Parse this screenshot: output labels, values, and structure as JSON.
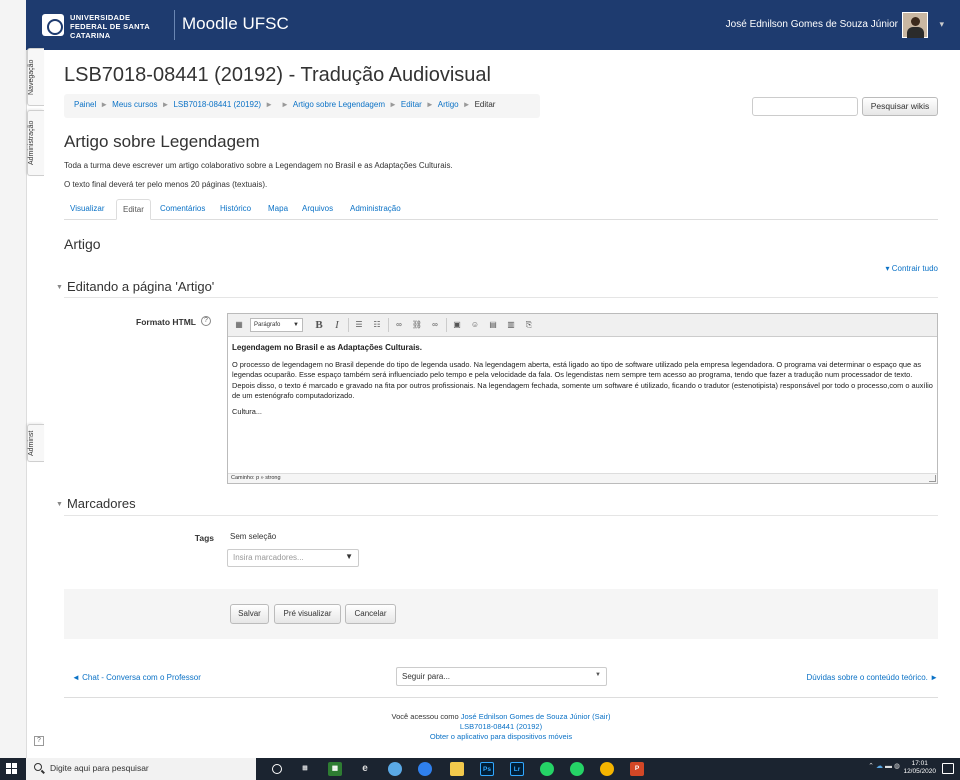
{
  "header": {
    "university": "UNIVERSIDADE FEDERAL DE SANTA CATARINA",
    "brand": "Moodle UFSC",
    "user_name": "José Ednilson Gomes de Souza Júnior"
  },
  "side_tabs": {
    "navigation": "Navegação",
    "administration": "Administração",
    "admin": "Adminst"
  },
  "course": {
    "title": "LSB7018-08441 (20192) - Tradução Audiovisual"
  },
  "breadcrumb": [
    {
      "label": "Painel"
    },
    {
      "label": "Meus cursos"
    },
    {
      "label": "LSB7018-08441 (20192)"
    },
    {
      "label": ""
    },
    {
      "label": "Artigo sobre Legendagem"
    },
    {
      "label": "Editar"
    },
    {
      "label": "Artigo"
    },
    {
      "label": "Editar"
    }
  ],
  "search": {
    "placeholder": "",
    "button_label": "Pesquisar wikis"
  },
  "wiki": {
    "title": "Artigo sobre Legendagem",
    "intro_1": "Toda a turma deve escrever um artigo colaborativo sobre a Legendagem no Brasil e as Adaptações Culturais.",
    "intro_2": "O texto final deverá ter pelo menos 20 páginas (textuais).",
    "tabs": [
      {
        "label": "Visualizar",
        "active": false
      },
      {
        "label": "Editar",
        "active": true
      },
      {
        "label": "Comentários",
        "active": false
      },
      {
        "label": "Histórico",
        "active": false
      },
      {
        "label": "Mapa",
        "active": false
      },
      {
        "label": "Arquivos",
        "active": false
      },
      {
        "label": "Administração",
        "active": false
      }
    ],
    "page_title": "Artigo",
    "collapse_all": "Contrair tudo"
  },
  "editing_section": {
    "legend": "Editando a página 'Artigo'",
    "format_label": "Formato HTML",
    "paragraph_select": "Parágrafo",
    "content_heading": "Legendagem no Brasil e as Adaptações Culturais.",
    "content_paragraph": "O processo de legendagem no Brasil depende do tipo de legenda usado. Na legendagem aberta, está ligado ao tipo de software utilizado pela empresa legendadora. O programa vai determinar o espaço que as legendas ocuparão. Esse espaço também será influenciado pelo tempo e pela velocidade da fala. Os legendistas nem sempre tem acesso ao programa, tendo que fazer a tradução num processador de texto. Depois disso, o texto é marcado e gravado na fita por outros profissionais. Na legendagem fechada, somente um software é utilizado, ficando o tradutor (estenotipista) responsável por todo o processo,com o auxílio de um estenógrafo computadorizado.",
    "content_tail": "Cultura...",
    "status_path": "Caminho: p » strong"
  },
  "tags_section": {
    "legend": "Marcadores",
    "tags_label": "Tags",
    "no_selection": "Sem seleção",
    "input_placeholder": "Insira marcadores..."
  },
  "actions": {
    "save": "Salvar",
    "preview": "Pré visualizar",
    "cancel": "Cancelar"
  },
  "activity_nav": {
    "prev": "◄ Chat - Conversa com o Professor",
    "jump_placeholder": "Seguir para...",
    "next": "Dúvidas sobre o conteúdo teórico. ►"
  },
  "footer": {
    "logged_in_prefix": "Você acessou como ",
    "user_link": "José Ednilson Gomes de Souza Júnior",
    "logout": "(Sair)",
    "course_link": "LSB7018-08441 (20192)",
    "app_link": "Obter o aplicativo para dispositivos móveis"
  },
  "taskbar": {
    "search_placeholder": "Digite aqui para pesquisar",
    "time": "17:01",
    "date": "12/05/2020"
  },
  "colors": {
    "header_bg": "#1e3b6f",
    "link": "#0b72c6",
    "taskbar_bg": "#1b2430"
  }
}
